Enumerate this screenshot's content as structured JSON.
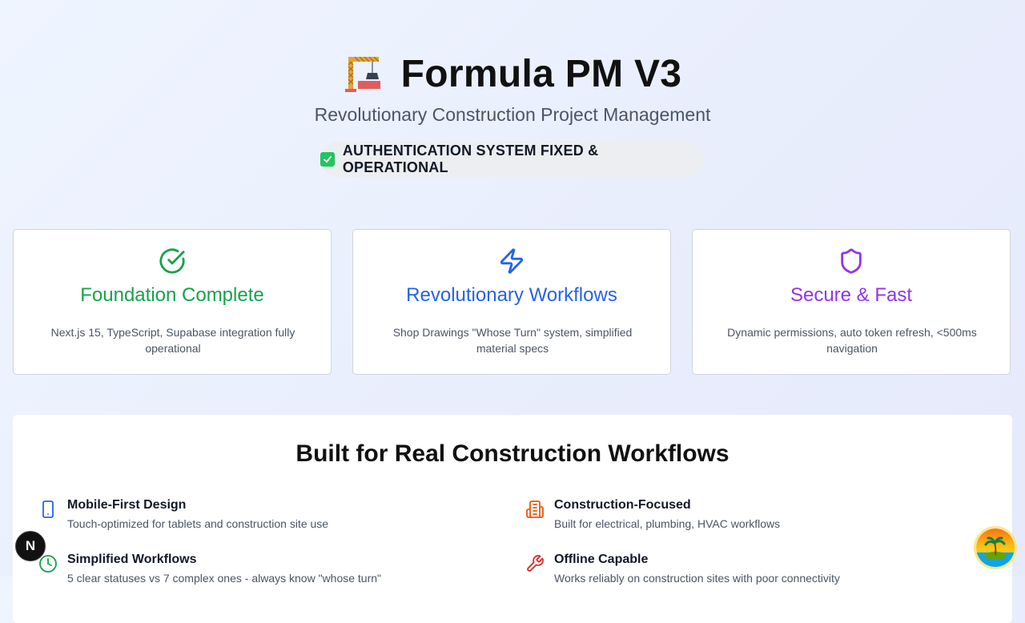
{
  "header": {
    "title": "Formula PM V3",
    "subtitle": "Revolutionary Construction Project Management",
    "status": "AUTHENTICATION SYSTEM FIXED & OPERATIONAL",
    "logo_icon": "construction-crane-icon"
  },
  "cards": [
    {
      "icon": "check-circle-icon",
      "title": "Foundation Complete",
      "description": "Next.js 15, TypeScript, Supabase integration fully operational",
      "color": "#16a34a"
    },
    {
      "icon": "lightning-bolt-icon",
      "title": "Revolutionary Workflows",
      "description": "Shop Drawings \"Whose Turn\" system, simplified material specs",
      "color": "#2563eb"
    },
    {
      "icon": "shield-icon",
      "title": "Secure & Fast",
      "description": "Dynamic permissions, auto token refresh, <500ms navigation",
      "color": "#9333ea"
    }
  ],
  "features_panel": {
    "title": "Built for Real Construction Workflows",
    "items": [
      {
        "icon": "smartphone-icon",
        "title": "Mobile-First Design",
        "description": "Touch-optimized for tablets and construction site use",
        "color": "#2563eb"
      },
      {
        "icon": "building-icon",
        "title": "Construction-Focused",
        "description": "Built for electrical, plumbing, HVAC workflows",
        "color": "#ea580c"
      },
      {
        "icon": "clock-icon",
        "title": "Simplified Workflows",
        "description": "5 clear statuses vs 7 complex ones - always know \"whose turn\"",
        "color": "#16a34a"
      },
      {
        "icon": "wrench-icon",
        "title": "Offline Capable",
        "description": "Works reliably on construction sites with poor connectivity",
        "color": "#dc2626"
      }
    ]
  },
  "overlay": {
    "next_badge": "N",
    "avatar_icon": "palm-island-avatar-icon"
  }
}
